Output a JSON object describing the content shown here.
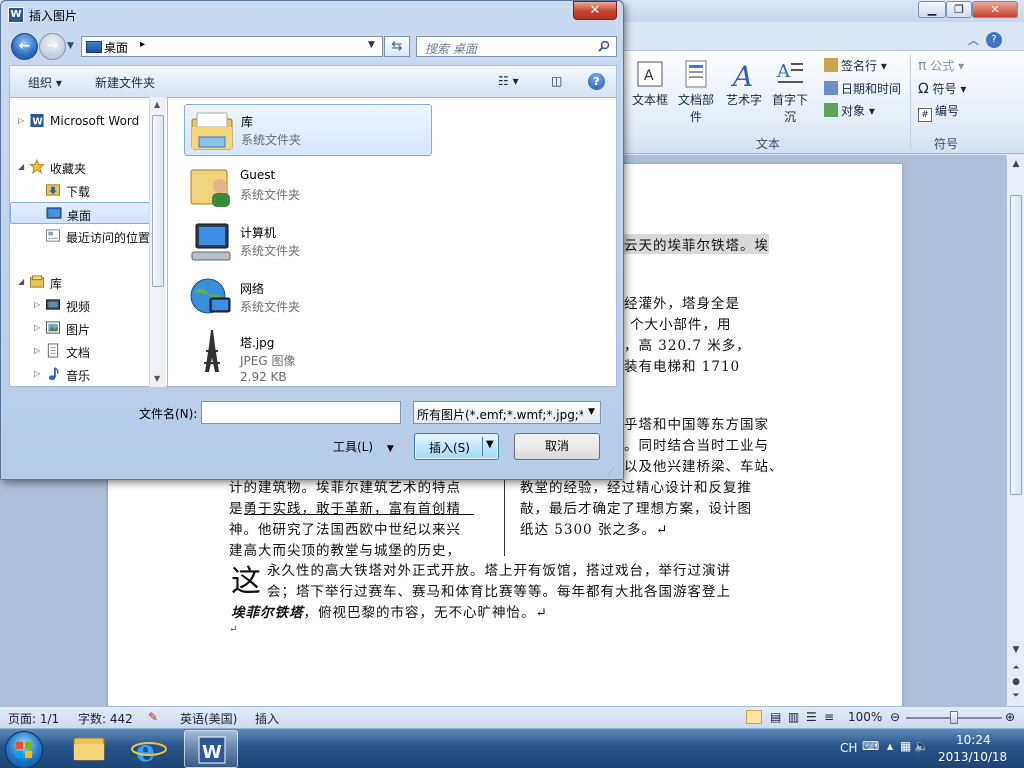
{
  "dialog": {
    "title": "插入图片",
    "close_label": "✕",
    "app_icon_label": "W",
    "address": {
      "location": "桌面"
    },
    "search": {
      "placeholder": "搜索 桌面"
    },
    "toolbar": {
      "organize": "组织 ▾",
      "new_folder": "新建文件夹",
      "help": "?"
    },
    "nav": [
      {
        "label": "Microsoft Word",
        "icon": "word-icon",
        "level": 0,
        "expander": "▷"
      },
      {
        "label": "收藏夹",
        "icon": "star-icon",
        "level": 0,
        "expander": "◢"
      },
      {
        "label": "下载",
        "icon": "download-folder-icon",
        "level": 1,
        "expander": ""
      },
      {
        "label": "桌面",
        "icon": "desktop-icon",
        "level": 1,
        "expander": "",
        "selected": true
      },
      {
        "label": "最近访问的位置",
        "icon": "recent-icon",
        "level": 1,
        "expander": ""
      },
      {
        "label": "库",
        "icon": "library-icon",
        "level": 0,
        "expander": "◢"
      },
      {
        "label": "视频",
        "icon": "video-icon",
        "level": 1,
        "expander": "▷"
      },
      {
        "label": "图片",
        "icon": "pictures-icon",
        "level": 1,
        "expander": "▷"
      },
      {
        "label": "文档",
        "icon": "documents-icon",
        "level": 1,
        "expander": "▷"
      },
      {
        "label": "音乐",
        "icon": "music-icon",
        "level": 1,
        "expander": "▷"
      }
    ],
    "files": [
      {
        "name": "库",
        "type": "系统文件夹",
        "size": "",
        "icon": "library-folder-icon",
        "selected": true
      },
      {
        "name": "Guest",
        "type": "系统文件夹",
        "size": "",
        "icon": "user-folder-icon"
      },
      {
        "name": "计算机",
        "type": "系统文件夹",
        "size": "",
        "icon": "computer-icon"
      },
      {
        "name": "网络",
        "type": "系统文件夹",
        "size": "",
        "icon": "network-icon"
      },
      {
        "name": "塔.jpg",
        "type": "JPEG 图像",
        "size": "2.92 KB",
        "icon": "tower-image-icon"
      }
    ],
    "filename_label": "文件名(N):",
    "filename_value": "",
    "filter_value": "所有图片(*.emf;*.wmf;*.jpg;*.jp",
    "tools_label": "工具(L)",
    "insert_label": "插入(S)",
    "cancel_label": "取消"
  },
  "word": {
    "ribbon": {
      "text_group": {
        "label": "文本",
        "textbox": "文本框",
        "quickparts": "文档部件",
        "wordart": "艺术字",
        "dropcap": "首字下沉",
        "signature": "签名行",
        "datetime": "日期和时间",
        "object": "对象"
      },
      "symbols_group": {
        "label": "符号",
        "equation": "公式",
        "symbol": "符号",
        "number": "编号"
      }
    },
    "document": {
      "lines_right_top": [
        "云天的埃菲尔铁塔。埃",
        "经灌外，塔身全是",
        "个大小部件，用",
        "，高 320.7 米多，",
        "装有电梯和 1710"
      ],
      "lines_right_mid": [
        "乎塔和中国等东方国家",
        "。同时结合当时工业与",
        "以及他兴建桥梁、车站、",
        "教堂的经验，经过精心设计和反复推",
        "敲，最后才确定了理想方案，设计图",
        "纸达 5300 张之多。↵"
      ],
      "lines_left": [
        "计的建筑物。埃菲尔建筑艺术的特点",
        "是勇于实践，敢于革新，富有首创精",
        "神。他研究了法国西欧中世纪以来兴",
        "建高大而尖顶的教堂与城堡的历史，"
      ],
      "dropcap_char": "这",
      "dropcap_line1": "永久性的高大铁塔对外正式开放。塔上开有饭馆，搭过戏台，举行过演讲",
      "dropcap_line2": "会；塔下举行过赛车、赛马和体育比赛等等。每年都有大批各国游客登上",
      "last_line_bold": "埃菲尔铁塔",
      "last_line_rest": "，俯视巴黎的市容，无不心旷神怡。↵",
      "para_mark": "↵"
    },
    "status": {
      "page": "页面: 1/1",
      "words": "字数: 442",
      "language": "英语(美国)",
      "mode": "插入",
      "zoom": "100%"
    }
  },
  "taskbar": {
    "ime": "CH",
    "time": "10:24",
    "date": "2013/10/18"
  },
  "colors": {
    "accent": "#3c7fb1",
    "selection": "#cfe2f8",
    "taskbar": "#27548a"
  }
}
